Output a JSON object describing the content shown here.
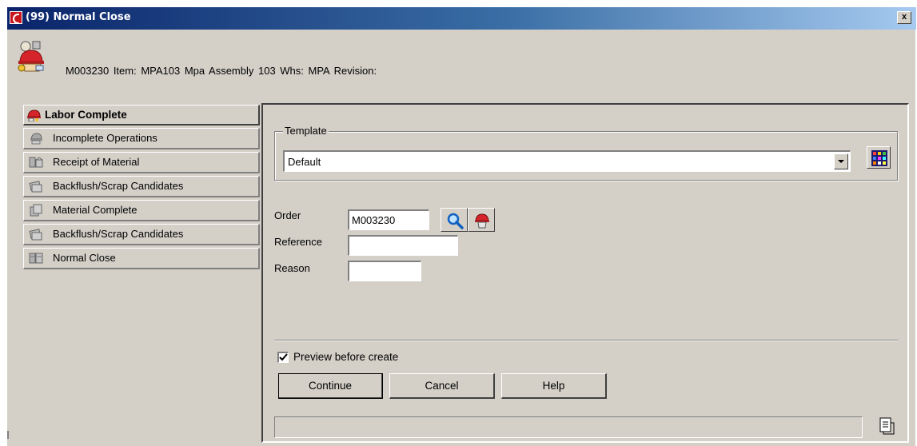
{
  "window": {
    "title": "(99) Normal Close",
    "close_label": "x"
  },
  "header": {
    "info": "M003230  Item: MPA103  Mpa Assembly 103  Whs: MPA  Revision:",
    "icon": "worker-with-helmet-icon"
  },
  "nav": {
    "items": [
      {
        "label": "Labor Complete",
        "icon": "labor-complete-icon",
        "active": true
      },
      {
        "label": "Incomplete Operations",
        "icon": "incomplete-operations-icon"
      },
      {
        "label": "Receipt of Material",
        "icon": "receipt-of-material-icon"
      },
      {
        "label": "Backflush/Scrap Candidates",
        "icon": "backflush-icon"
      },
      {
        "label": "Material Complete",
        "icon": "material-complete-icon"
      },
      {
        "label": "Backflush/Scrap Candidates",
        "icon": "backflush-icon"
      },
      {
        "label": "Normal Close",
        "icon": "normal-close-icon"
      }
    ]
  },
  "form": {
    "template_legend": "Template",
    "template_value": "Default",
    "order_label": "Order",
    "order_value": "M003230",
    "reference_label": "Reference",
    "reference_value": "",
    "reason_label": "Reason",
    "reason_value": "",
    "preview_label": "Preview before create",
    "preview_checked": true
  },
  "buttons": {
    "continue": "Continue",
    "cancel": "Cancel",
    "help": "Help"
  },
  "colors": {
    "titlebar_start": "#0a246a",
    "titlebar_end": "#a6caf0",
    "face": "#d4d0c8"
  }
}
